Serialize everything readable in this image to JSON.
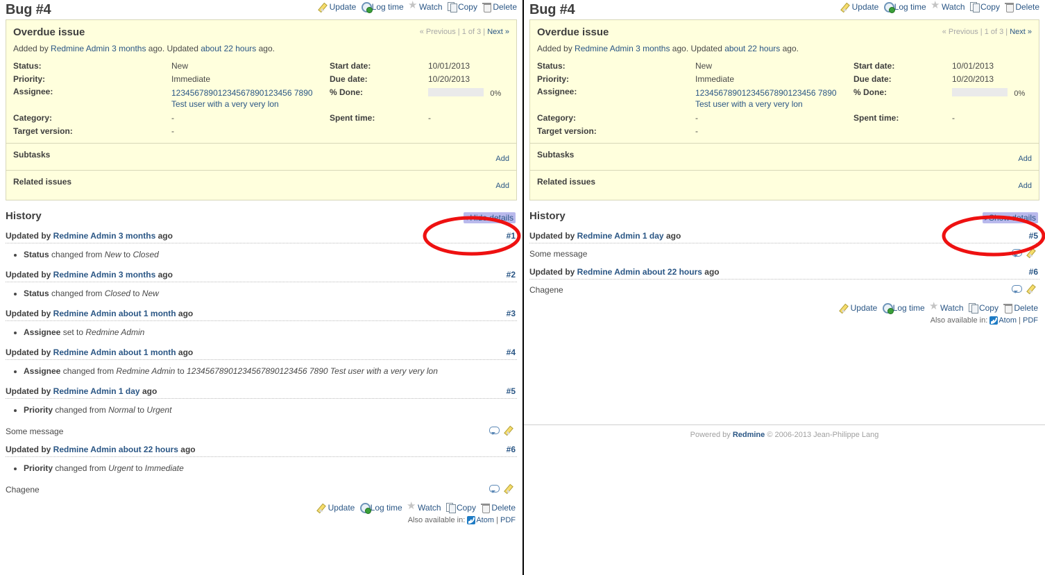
{
  "issue": {
    "title": "Bug #4",
    "subject": "Overdue issue",
    "nav": {
      "previous": "« Previous",
      "separator_left": " | ",
      "counter": "1 of 3",
      "separator_right": " | ",
      "next": "Next »"
    },
    "author_line": {
      "prefix": "Added by ",
      "author": "Redmine Admin",
      "added_ago": "3 months",
      "mid": " ago. Updated ",
      "updated_ago": "about 22 hours",
      "suffix": " ago."
    },
    "attributes": {
      "status_label": "Status:",
      "status_value": "New",
      "priority_label": "Priority:",
      "priority_value": "Immediate",
      "assignee_label": "Assignee:",
      "assignee_value": "12345678901234567890123456 7890 Test user with a very very lon",
      "assignee_line1": "12345678901234567890123456 7890",
      "assignee_line2": "Test user with a very very lon",
      "category_label": "Category:",
      "category_value": "-",
      "target_version_label": "Target version:",
      "target_version_value": "-",
      "start_date_label": "Start date:",
      "start_date_value": "10/01/2013",
      "due_date_label": "Due date:",
      "due_date_value": "10/20/2013",
      "done_label": "% Done:",
      "done_value": "0%",
      "done_percent": 0,
      "spent_time_label": "Spent time:",
      "spent_time_value": "-"
    },
    "subtasks_label": "Subtasks",
    "subtasks_add": "Add",
    "related_label": "Related issues",
    "related_add": "Add"
  },
  "contextual_actions": [
    {
      "label": "Update",
      "icon": "pencil-icon"
    },
    {
      "label": "Log time",
      "icon": "clock-add-icon"
    },
    {
      "label": "Watch",
      "icon": "star-icon"
    },
    {
      "label": "Copy",
      "icon": "copy-icon"
    },
    {
      "label": "Delete",
      "icon": "trash-icon"
    }
  ],
  "history": {
    "heading": "History",
    "toggle_hide": "Hide details",
    "toggle_show": "Show details",
    "caret_down": "▾",
    "caret_right": "▸"
  },
  "journals_expanded": [
    {
      "prefix": "Updated by ",
      "user": "Redmine Admin",
      "ago": "3 months",
      "suffix": " ago",
      "num": "#1",
      "details": [
        {
          "field": "Status",
          "text": " changed from ",
          "from": "New",
          "mid": " to ",
          "to": "Closed"
        }
      ],
      "note": null
    },
    {
      "prefix": "Updated by ",
      "user": "Redmine Admin",
      "ago": "3 months",
      "suffix": " ago",
      "num": "#2",
      "details": [
        {
          "field": "Status",
          "text": " changed from ",
          "from": "Closed",
          "mid": " to ",
          "to": "New"
        }
      ],
      "note": null
    },
    {
      "prefix": "Updated by ",
      "user": "Redmine Admin",
      "ago": "about 1 month",
      "suffix": " ago",
      "num": "#3",
      "details": [
        {
          "field": "Assignee",
          "text": " set to ",
          "from": "Redmine Admin",
          "mid": "",
          "to": ""
        }
      ],
      "note": null
    },
    {
      "prefix": "Updated by ",
      "user": "Redmine Admin",
      "ago": "about 1 month",
      "suffix": " ago",
      "num": "#4",
      "details": [
        {
          "field": "Assignee",
          "text": " changed from ",
          "from": "Redmine Admin",
          "mid": " to ",
          "to": "12345678901234567890123456 7890 Test user with a very very lon"
        }
      ],
      "note": null
    },
    {
      "prefix": "Updated by ",
      "user": "Redmine Admin",
      "ago": "1 day",
      "suffix": " ago",
      "num": "#5",
      "details": [
        {
          "field": "Priority",
          "text": " changed from ",
          "from": "Normal",
          "mid": " to ",
          "to": "Urgent"
        }
      ],
      "note": "Some message"
    },
    {
      "prefix": "Updated by ",
      "user": "Redmine Admin",
      "ago": "about 22 hours",
      "suffix": " ago",
      "num": "#6",
      "details": [
        {
          "field": "Priority",
          "text": " changed from ",
          "from": "Urgent",
          "mid": " to ",
          "to": "Immediate"
        }
      ],
      "note": "Chagene"
    }
  ],
  "journals_collapsed": [
    {
      "prefix": "Updated by ",
      "user": "Redmine Admin",
      "ago": "1 day",
      "suffix": " ago",
      "num": "#5",
      "note": "Some message"
    },
    {
      "prefix": "Updated by ",
      "user": "Redmine Admin",
      "ago": "about 22 hours",
      "suffix": " ago",
      "num": "#6",
      "note": "Chagene"
    }
  ],
  "note_icons": [
    {
      "name": "quote-icon"
    },
    {
      "name": "edit-pencil-icon"
    }
  ],
  "other_formats": {
    "label": "Also available in:",
    "atom": "Atom",
    "sep": "|",
    "pdf": "PDF"
  },
  "footer": {
    "powered_by": "Powered by ",
    "redmine": "Redmine",
    "copyright": " © 2006-2013 Jean-Philippe Lang"
  },
  "colors": {
    "link": "#2a5685",
    "issue_bg": "#ffffdd",
    "issue_border": "#d7d7b8",
    "highlight": "#b9b9ec",
    "annotation": "#ee1111",
    "text": "#484848"
  }
}
